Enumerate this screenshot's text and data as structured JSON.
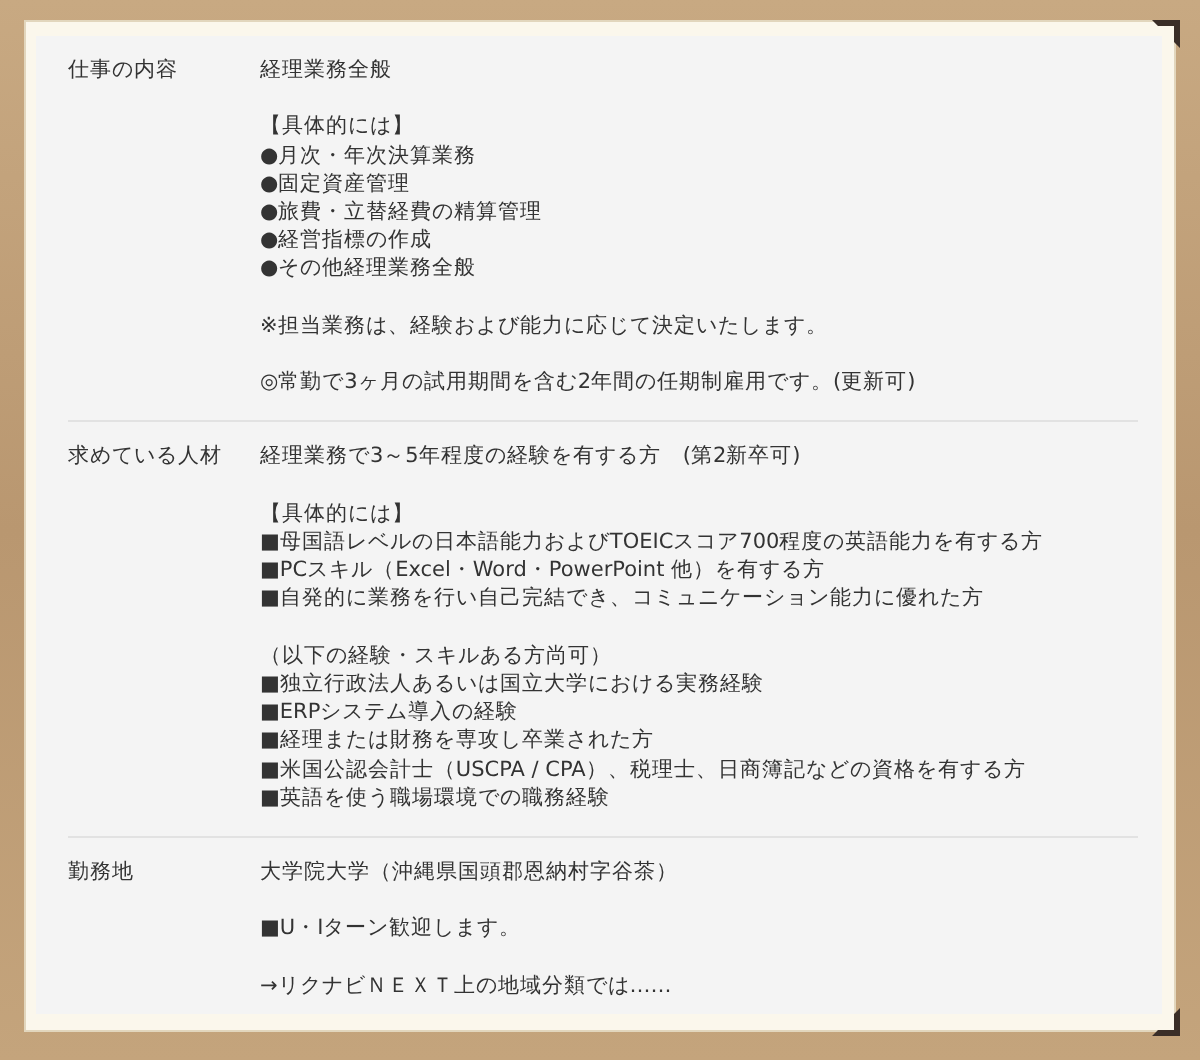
{
  "rows": [
    {
      "label": "仕事の内容",
      "blocks": [
        {
          "lines": [
            "経理業務全般"
          ]
        },
        {
          "lines": [
            "【具体的には】",
            "●月次・年次決算業務",
            "●固定資産管理",
            "●旅費・立替経費の精算管理",
            "●経営指標の作成",
            "●その他経理業務全般"
          ]
        },
        {
          "lines": [
            "※担当業務は、経験および能力に応じて決定いたします。"
          ]
        },
        {
          "lines": [
            "◎常勤で3ヶ月の試用期間を含む2年間の任期制雇用です。(更新可)"
          ]
        }
      ]
    },
    {
      "label": "求めている人材",
      "blocks": [
        {
          "lines": [
            "経理業務で3～5年程度の経験を有する方　(第2新卒可)"
          ]
        },
        {
          "lines": [
            "【具体的には】",
            "■母国語レベルの日本語能力およびTOEICスコア700程度の英語能力を有する方",
            "■PCスキル（Excel・Word・PowerPoint 他）を有する方",
            "■自発的に業務を行い自己完結でき、コミュニケーション能力に優れた方"
          ]
        },
        {
          "lines": [
            "（以下の経験・スキルある方尚可）",
            "■独立行政法人あるいは国立大学における実務経験",
            "■ERPシステム導入の経験",
            "■経理または財務を専攻し卒業された方",
            "■米国公認会計士（USCPA / CPA）、税理士、日商簿記などの資格を有する方",
            "■英語を使う職場環境での職務経験"
          ]
        }
      ]
    },
    {
      "label": "勤務地",
      "blocks": [
        {
          "lines": [
            "大学院大学（沖縄県国頭郡恩納村字谷茶）"
          ]
        },
        {
          "lines": [
            "■U・Iターン歓迎します。"
          ]
        },
        {
          "lines": [
            "→リクナビＮＥＸＴ上の地域分類では……"
          ]
        }
      ]
    }
  ]
}
